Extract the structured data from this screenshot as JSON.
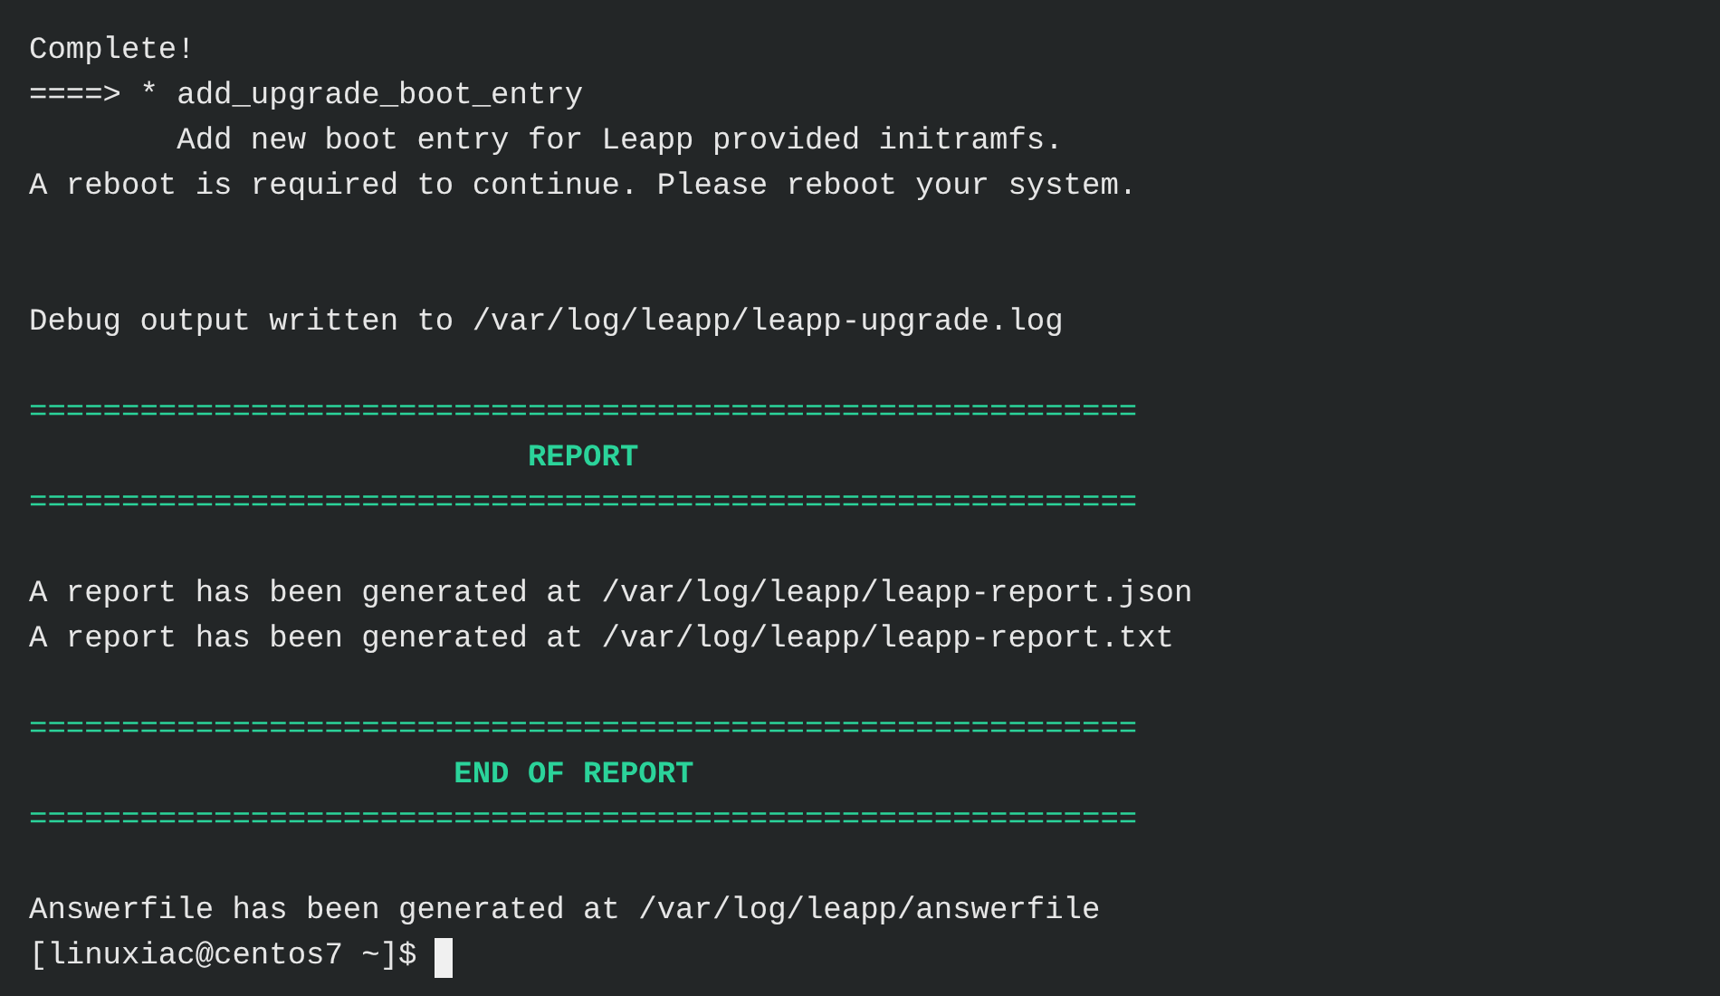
{
  "terminal": {
    "lines": [
      {
        "kind": "plain",
        "text": "Complete!"
      },
      {
        "kind": "plain",
        "text": "====> * add_upgrade_boot_entry"
      },
      {
        "kind": "plain",
        "text": "        Add new boot entry for Leapp provided initramfs."
      },
      {
        "kind": "plain",
        "text": "A reboot is required to continue. Please reboot your system."
      },
      {
        "kind": "blank"
      },
      {
        "kind": "blank"
      },
      {
        "kind": "plain",
        "text": "Debug output written to /var/log/leapp/leapp-upgrade.log"
      },
      {
        "kind": "blank"
      },
      {
        "kind": "rule",
        "text": "============================================================"
      },
      {
        "kind": "heading",
        "text": "                           REPORT"
      },
      {
        "kind": "rule",
        "text": "============================================================"
      },
      {
        "kind": "blank"
      },
      {
        "kind": "plain",
        "text": "A report has been generated at /var/log/leapp/leapp-report.json"
      },
      {
        "kind": "plain",
        "text": "A report has been generated at /var/log/leapp/leapp-report.txt"
      },
      {
        "kind": "blank"
      },
      {
        "kind": "rule",
        "text": "============================================================"
      },
      {
        "kind": "heading",
        "text": "                       END OF REPORT"
      },
      {
        "kind": "rule",
        "text": "============================================================"
      },
      {
        "kind": "blank"
      },
      {
        "kind": "plain",
        "text": "Answerfile has been generated at /var/log/leapp/answerfile"
      },
      {
        "kind": "prompt",
        "text": "[linuxiac@centos7 ~]$"
      }
    ]
  }
}
